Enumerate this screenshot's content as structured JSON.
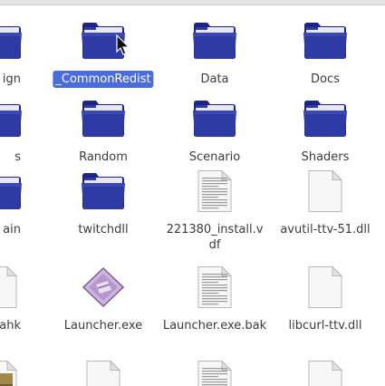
{
  "colors": {
    "folder_dark": "#1c2587",
    "folder_mid": "#2e3aa6",
    "folder_tab": "#e8e8f4",
    "selection": "#4a6cdc"
  },
  "rows": [
    [
      {
        "name": "ign",
        "icon": "folder-icon",
        "partial": true
      },
      {
        "name": "_CommonRedist",
        "icon": "folder-icon",
        "selected": true
      },
      {
        "name": "Data",
        "icon": "folder-icon"
      },
      {
        "name": "Docs",
        "icon": "folder-icon"
      }
    ],
    [
      {
        "name": "s",
        "icon": "folder-icon",
        "partial": true
      },
      {
        "name": "Random",
        "icon": "folder-icon"
      },
      {
        "name": "Scenario",
        "icon": "folder-icon"
      },
      {
        "name": "Shaders",
        "icon": "folder-icon"
      }
    ],
    [
      {
        "name": "ain",
        "icon": "folder-icon",
        "partial": true
      },
      {
        "name": "twitchdll",
        "icon": "folder-icon"
      },
      {
        "name": "221380_install.vdf",
        "icon": "text-file-icon"
      },
      {
        "name": "avutil-ttv-51.dll",
        "icon": "blank-file-icon"
      }
    ],
    [
      {
        "name": ".ahk",
        "icon": "blank-file-icon",
        "partial": true
      },
      {
        "name": "Launcher.exe",
        "icon": "executable-icon"
      },
      {
        "name": "Launcher.exe.bak",
        "icon": "text-file-icon"
      },
      {
        "name": "libcurl-ttv.dll",
        "icon": "blank-file-icon"
      }
    ],
    [
      {
        "name": "",
        "icon": "image-file-icon",
        "partial": true
      },
      {
        "name": "",
        "icon": "blank-file-icon"
      },
      {
        "name": "",
        "icon": "text-file-icon"
      },
      {
        "name": "",
        "icon": "blank-file-icon"
      }
    ]
  ]
}
